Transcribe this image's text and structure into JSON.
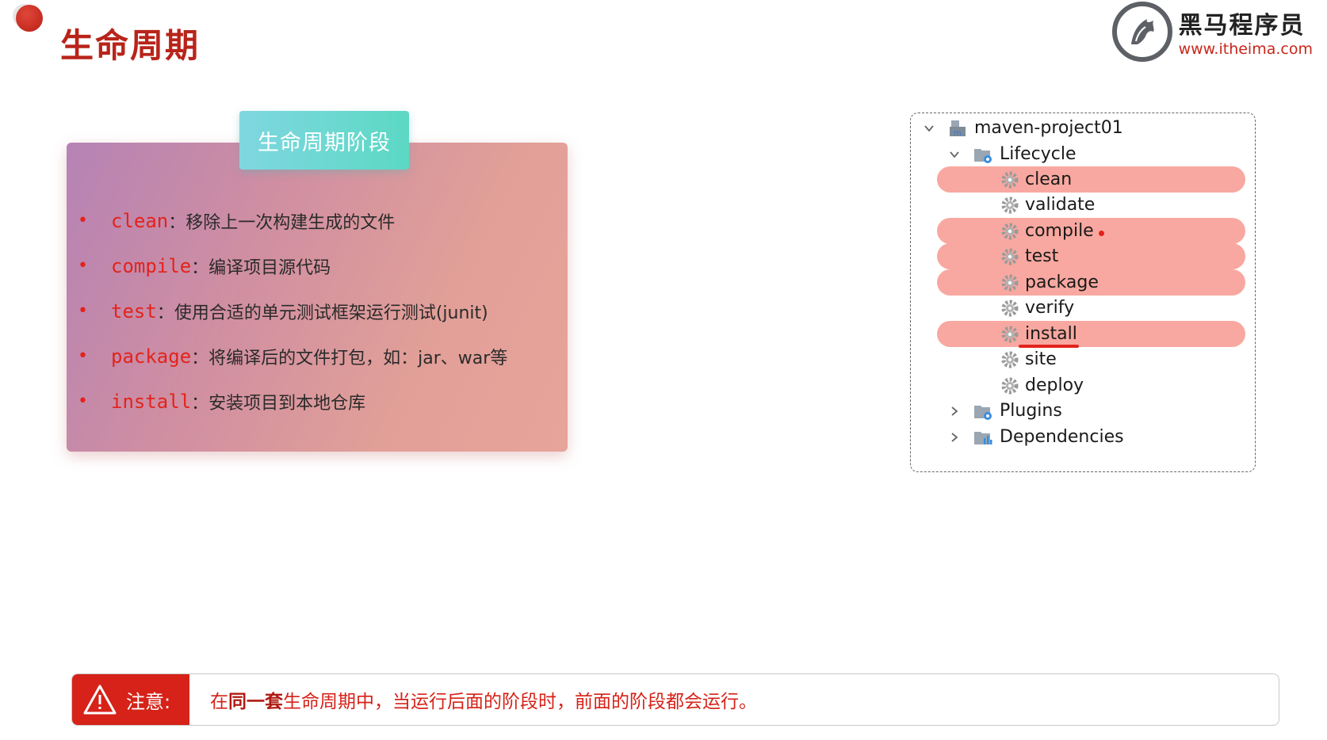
{
  "page": {
    "title": "生命周期"
  },
  "logo": {
    "name": "黑马程序员",
    "url": "www.itheima.com"
  },
  "card": {
    "tab_label": "生命周期阶段",
    "items": [
      {
        "keyword": "clean",
        "separator": "：",
        "description": "移除上一次构建生成的文件"
      },
      {
        "keyword": "compile",
        "separator": "：",
        "description": "编译项目源代码"
      },
      {
        "keyword": "test",
        "separator": "：",
        "description": "使用合适的单元测试框架运行测试(junit)"
      },
      {
        "keyword": "package",
        "separator": "：",
        "description": "将编译后的文件打包，如：jar、war等"
      },
      {
        "keyword": "install",
        "separator": "：",
        "description": "安装项目到本地仓库"
      }
    ]
  },
  "tree": {
    "project": "maven-project01",
    "lifecycle": {
      "label": "Lifecycle",
      "phases": [
        {
          "name": "clean",
          "highlighted": true
        },
        {
          "name": "validate",
          "highlighted": false
        },
        {
          "name": "compile",
          "highlighted": true
        },
        {
          "name": "test",
          "highlighted": true
        },
        {
          "name": "package",
          "highlighted": true
        },
        {
          "name": "verify",
          "highlighted": false
        },
        {
          "name": "install",
          "highlighted": true,
          "underlined": true
        },
        {
          "name": "site",
          "highlighted": false
        },
        {
          "name": "deploy",
          "highlighted": false
        }
      ]
    },
    "plugins": "Plugins",
    "dependencies": "Dependencies"
  },
  "note": {
    "label": "注意:",
    "text_prefix": "在",
    "text_bold": "同一套",
    "text_suffix": "生命周期中，当运行后面的阶段时，前面的阶段都会运行。"
  },
  "colors": {
    "accent_red": "#d62218",
    "highlight": "#f8a8a0",
    "tab_teal": "#5cd8c4"
  }
}
